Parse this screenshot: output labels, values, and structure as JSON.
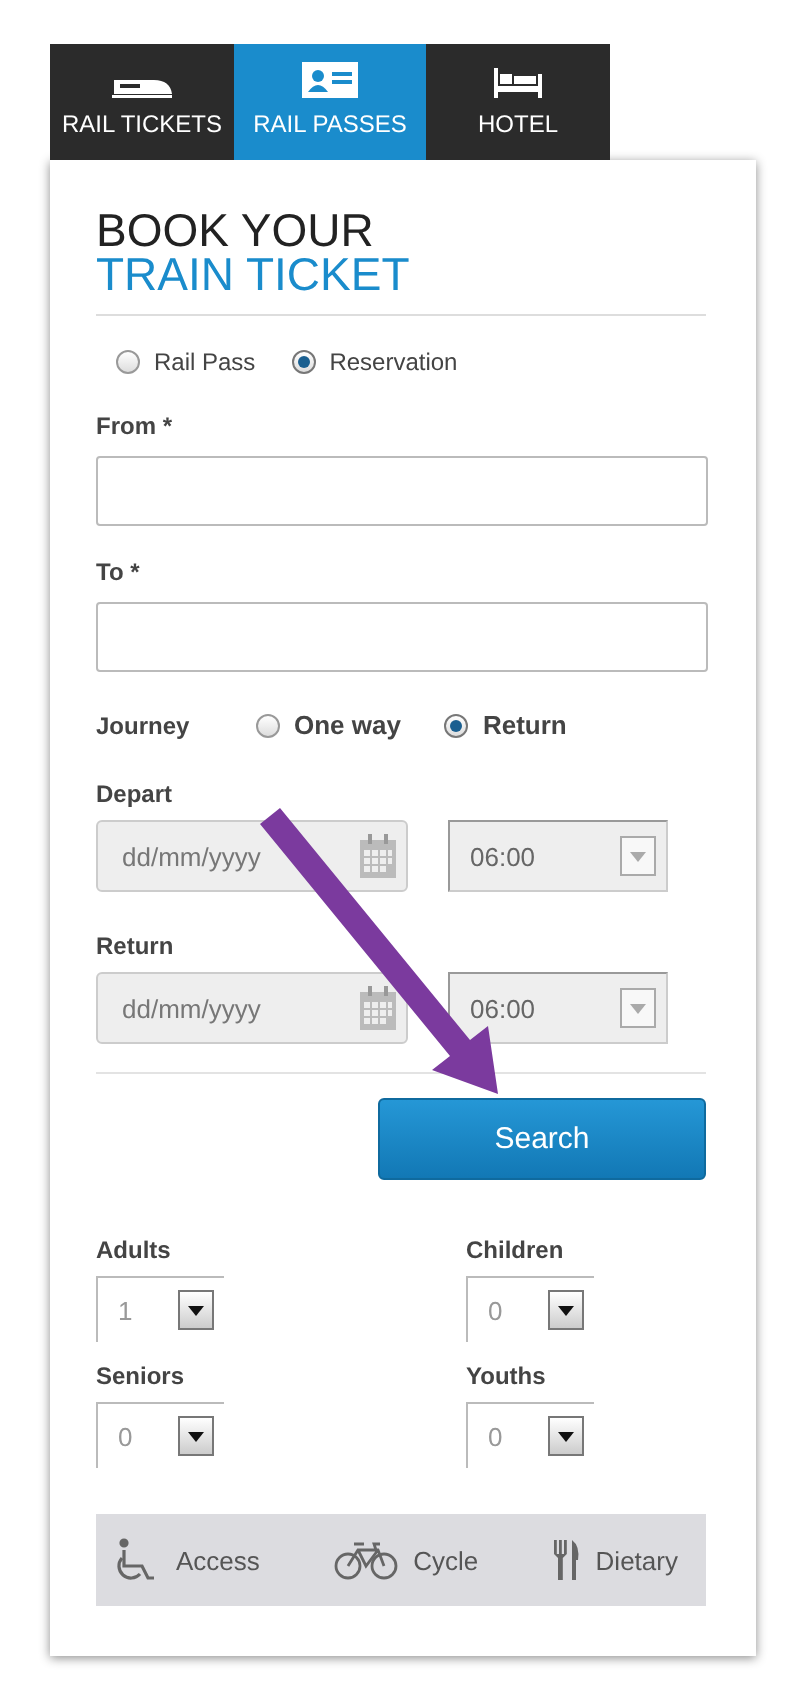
{
  "tabs": [
    {
      "label": "RAIL TICKETS",
      "selected": false
    },
    {
      "label": "RAIL PASSES",
      "selected": true
    },
    {
      "label": "HOTEL",
      "selected": false
    }
  ],
  "heading": {
    "line_1": "BOOK YOUR",
    "line_2": "TRAIN TICKET"
  },
  "booking_type": [
    {
      "label": "Rail Pass",
      "selected": false
    },
    {
      "label": "Reservation",
      "selected": true
    }
  ],
  "from": {
    "label": "From *"
  },
  "to": {
    "label": "To *"
  },
  "journey": {
    "label": "Journey",
    "options": [
      {
        "label": "One way",
        "selected": false
      },
      {
        "label": "Return",
        "selected": true
      }
    ]
  },
  "dates": [
    {
      "label": "Depart",
      "placeholder": "dd/mm/yyyy",
      "time": "06:00"
    },
    {
      "label": "Return",
      "placeholder": "dd/mm/yyyy",
      "time": "06:00"
    }
  ],
  "search_button": "Search",
  "passengers": [
    {
      "label": "Adults",
      "value": "1"
    },
    {
      "label": "Children",
      "value": "0"
    },
    {
      "label": "Seniors",
      "value": "0"
    },
    {
      "label": "Youths",
      "value": "0"
    }
  ],
  "extras": [
    {
      "label": "Access",
      "kind": "wheelchair"
    },
    {
      "label": "Cycle",
      "kind": "bicycle"
    },
    {
      "label": "Dietary",
      "kind": "cutlery"
    }
  ]
}
